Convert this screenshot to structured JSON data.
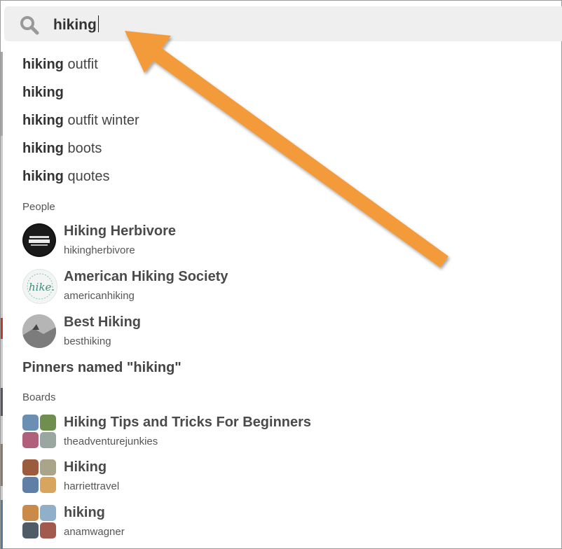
{
  "search": {
    "value": "hiking",
    "icon": "search-icon"
  },
  "suggestions": [
    {
      "bold": "hiking",
      "rest": " outfit"
    },
    {
      "bold": "hiking",
      "rest": ""
    },
    {
      "bold": "hiking",
      "rest": " outfit winter"
    },
    {
      "bold": "hiking",
      "rest": " boots"
    },
    {
      "bold": "hiking",
      "rest": " quotes"
    }
  ],
  "people": {
    "heading": "People",
    "items": [
      {
        "name": "Hiking Herbivore",
        "username": "hikingherbivore"
      },
      {
        "name": "American Hiking Society",
        "username": "americanhiking"
      },
      {
        "name": "Best Hiking",
        "username": "besthiking"
      }
    ],
    "pinners_link": "Pinners named \"hiking\""
  },
  "boards": {
    "heading": "Boards",
    "items": [
      {
        "name": "Hiking Tips and Tricks For Beginners",
        "owner": "theadventurejunkies"
      },
      {
        "name": "Hiking",
        "owner": "harriettravel"
      },
      {
        "name": "hiking",
        "owner": "anamwagner"
      }
    ]
  },
  "colors": {
    "arrow": "#f39a3b",
    "search_bg": "#efefef",
    "text": "#444444"
  }
}
